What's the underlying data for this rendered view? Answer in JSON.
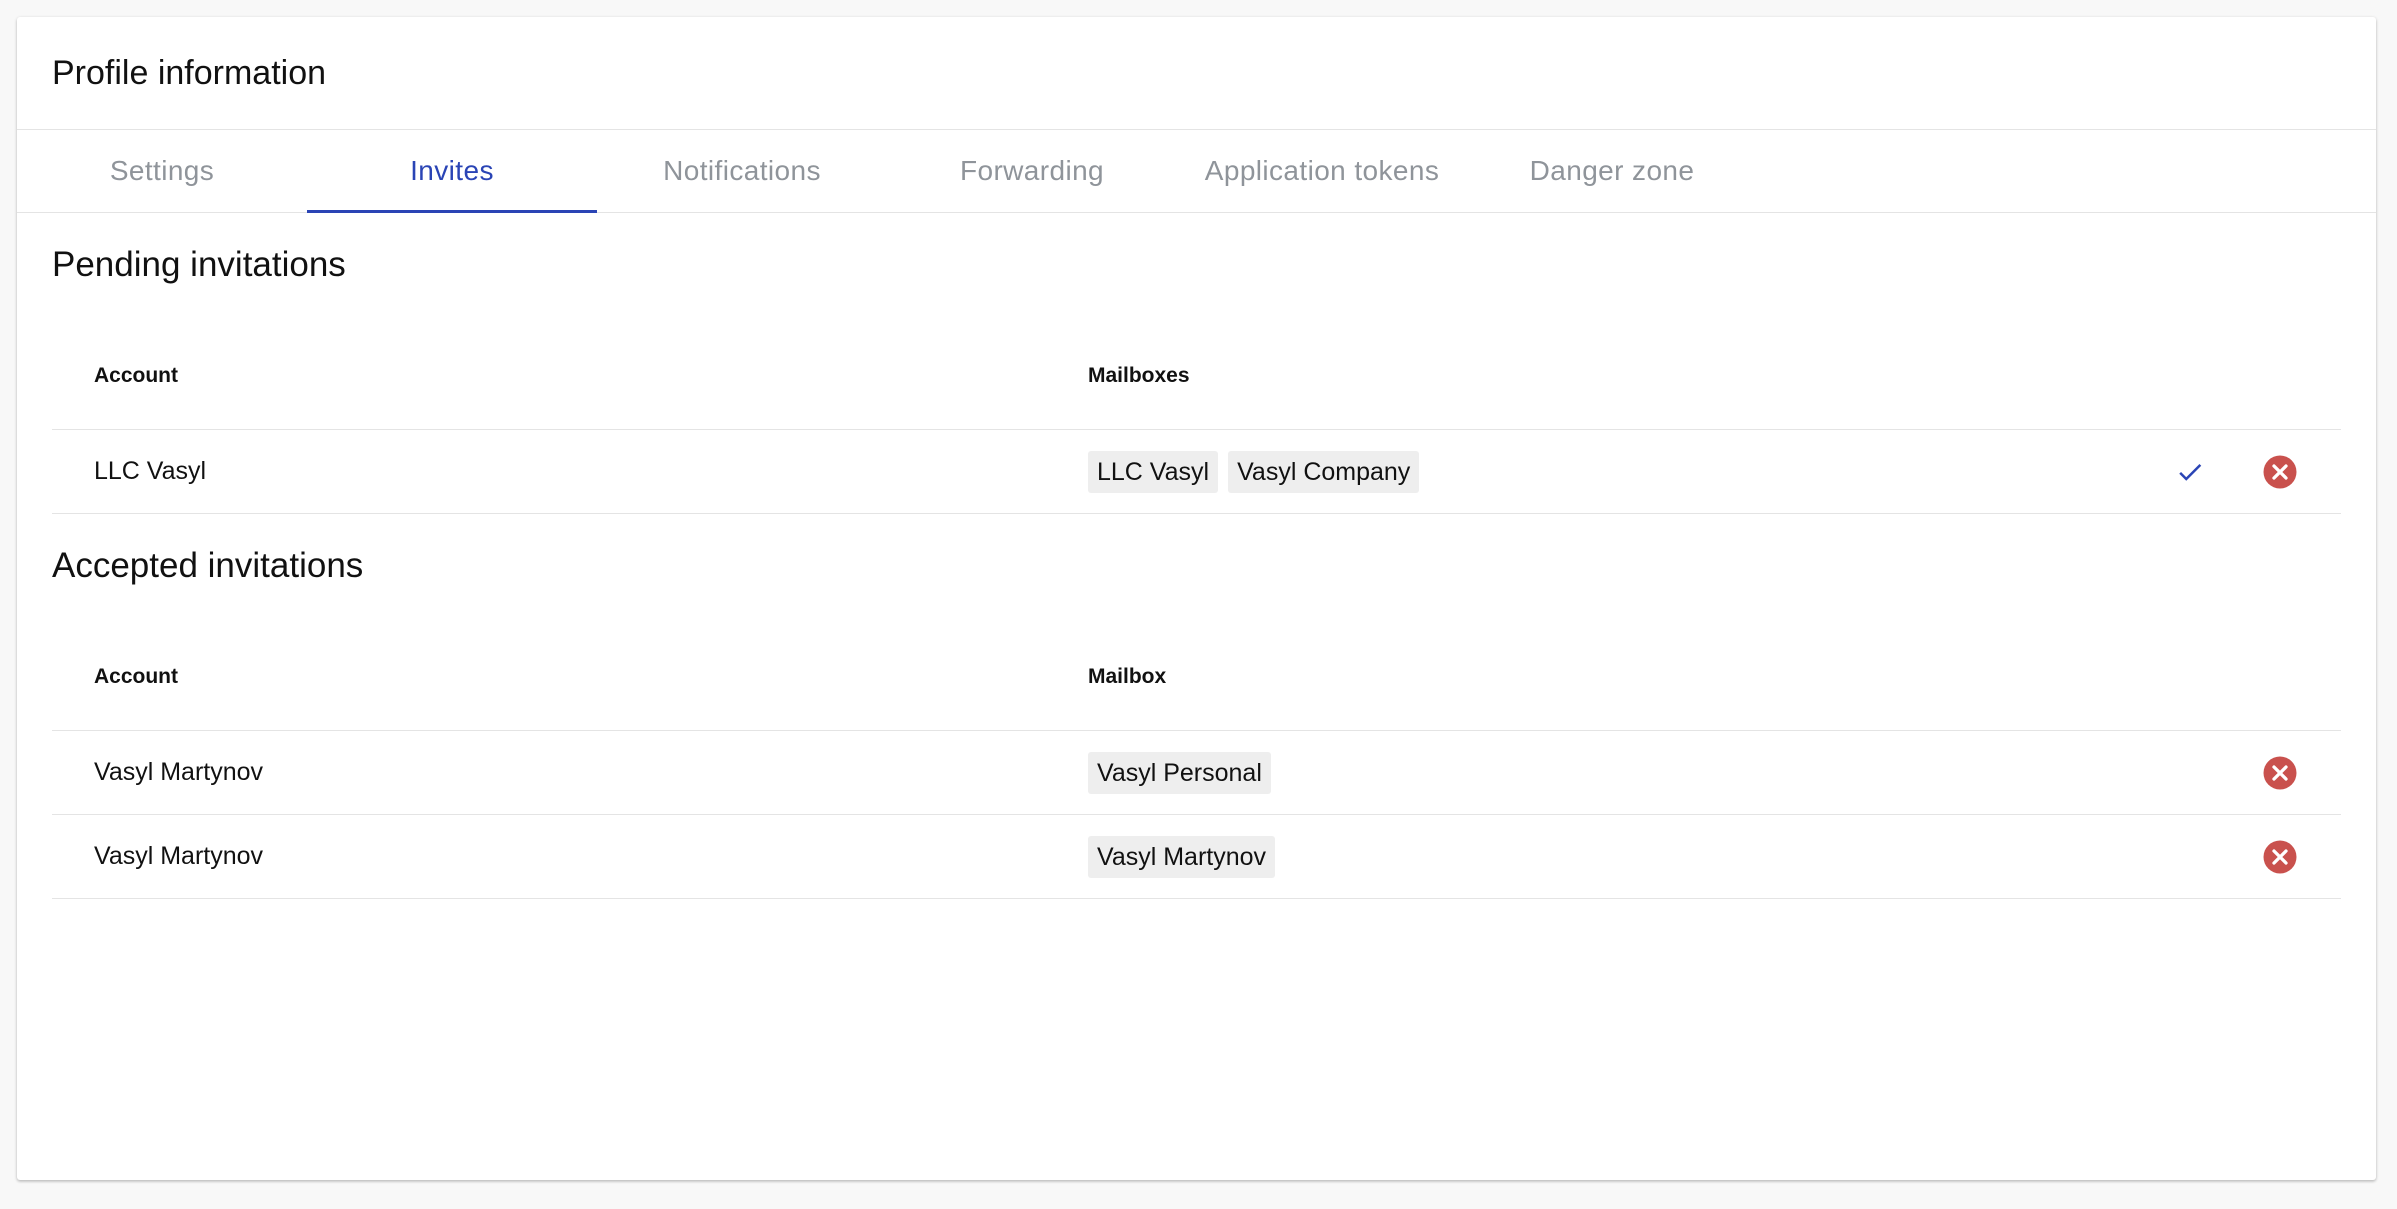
{
  "card": {
    "title": "Profile information"
  },
  "tabs": [
    {
      "label": "Settings",
      "active": false
    },
    {
      "label": "Invites",
      "active": true
    },
    {
      "label": "Notifications",
      "active": false
    },
    {
      "label": "Forwarding",
      "active": false
    },
    {
      "label": "Application tokens",
      "active": false
    },
    {
      "label": "Danger zone",
      "active": false
    }
  ],
  "pending": {
    "title": "Pending invitations",
    "headers": {
      "account": "Account",
      "mailboxes": "Mailboxes"
    },
    "rows": [
      {
        "account": "LLC Vasyl",
        "mailboxes": [
          "LLC Vasyl",
          "Vasyl Company"
        ],
        "actions": [
          "check-icon",
          "close-circle-icon"
        ]
      }
    ]
  },
  "accepted": {
    "title": "Accepted invitations",
    "headers": {
      "account": "Account",
      "mailbox": "Mailbox"
    },
    "rows": [
      {
        "account": "Vasyl Martynov",
        "mailbox": "Vasyl Personal",
        "actions": [
          "close-circle-icon"
        ]
      },
      {
        "account": "Vasyl Martynov",
        "mailbox": "Vasyl Martynov",
        "actions": [
          "close-circle-icon"
        ]
      }
    ]
  },
  "colors": {
    "accent": "#2a44b5",
    "danger": "#c9514d",
    "tab_inactive": "#8f949a"
  }
}
